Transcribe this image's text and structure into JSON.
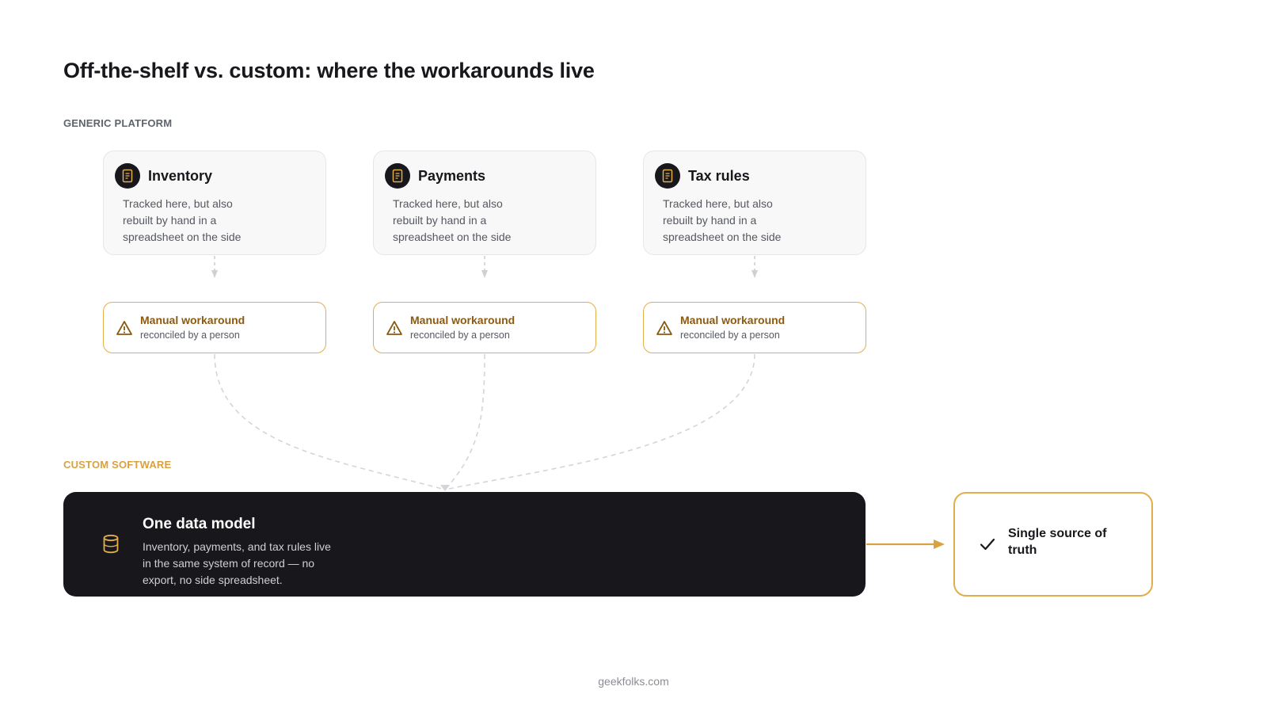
{
  "title": "Off-the-shelf vs. custom: where the workarounds live",
  "sections": {
    "generic_label": "GENERIC PLATFORM",
    "custom_label": "CUSTOM SOFTWARE"
  },
  "cards": [
    {
      "title": "Inventory",
      "description": "Tracked here, but also rebuilt by hand in a spreadsheet on the side",
      "icon": "document-icon"
    },
    {
      "title": "Payments",
      "description": "Tracked here, but also rebuilt by hand in a spreadsheet on the side",
      "icon": "document-icon"
    },
    {
      "title": "Tax rules",
      "description": "Tracked here, but also rebuilt by hand in a spreadsheet on the side",
      "icon": "document-icon"
    }
  ],
  "workarounds": [
    {
      "title": "Manual workaround",
      "subtitle": "reconciled by a person",
      "icon": "warning-icon"
    },
    {
      "title": "Manual workaround",
      "subtitle": "reconciled by a person",
      "icon": "warning-icon"
    },
    {
      "title": "Manual workaround",
      "subtitle": "reconciled by a person",
      "icon": "warning-icon"
    }
  ],
  "model": {
    "title": "One data model",
    "description": "Inventory, payments, and tax rules live in the same system of record — no export, no side spreadsheet.",
    "icon": "database-icon"
  },
  "outcome": {
    "text": "Single source of truth",
    "icon": "checkmark-icon"
  },
  "footer": "geekfolks.com",
  "colors": {
    "accent": "#e3ad4c",
    "accent_text": "#8a5a12",
    "dark": "#17171c",
    "connector": "#cfd0d3"
  }
}
